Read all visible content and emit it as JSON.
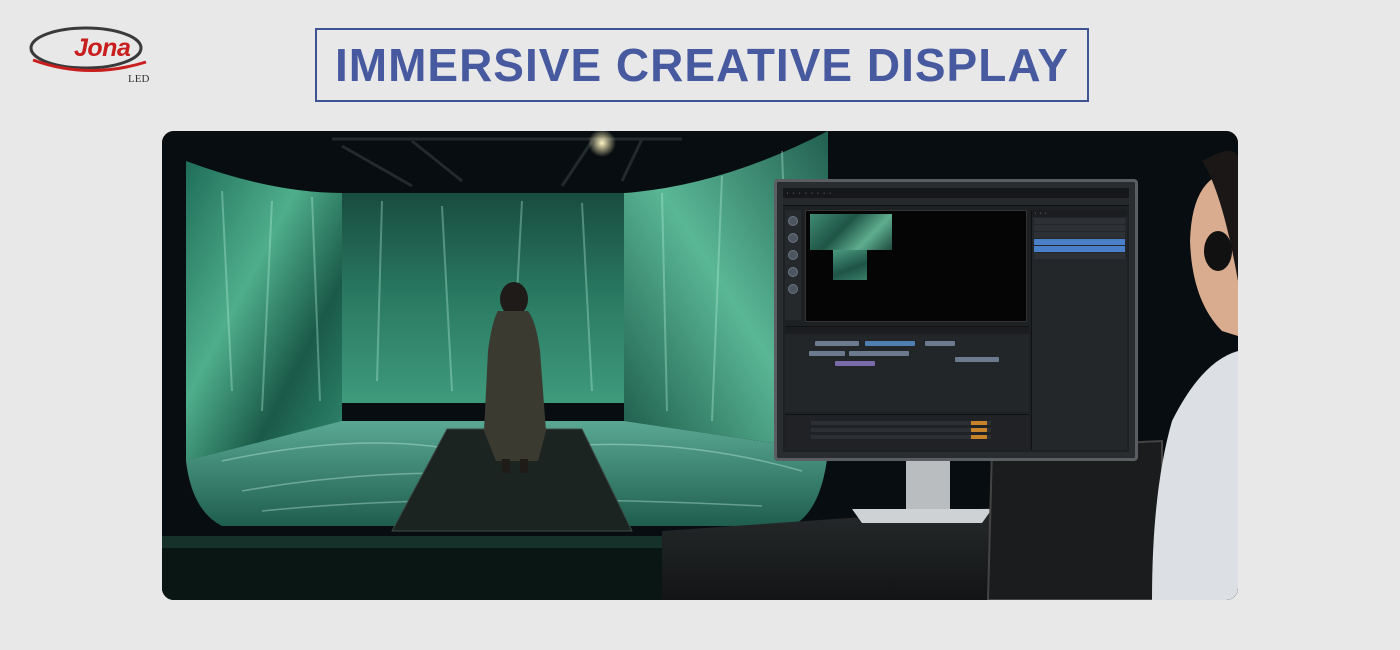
{
  "brand": {
    "name": "Jona",
    "sub": "LED",
    "primary_color": "#c81e1e",
    "swoosh_color": "#3a3a3a"
  },
  "title": {
    "text": "IMMERSIVE CREATIVE DISPLAY",
    "color": "#475aa0",
    "border_color": "#3f5393"
  },
  "scene": {
    "photo": "immersive-led-room-with-editing-monitor",
    "accent_green": "#3f9a7c"
  }
}
